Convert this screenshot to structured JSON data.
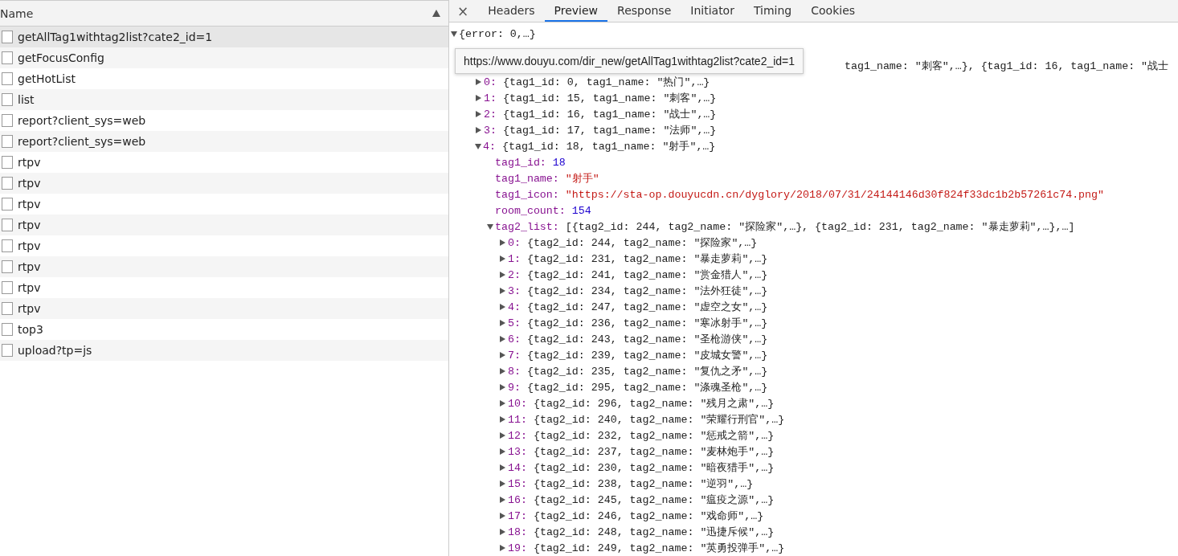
{
  "requests": {
    "column": "Name",
    "sorted_ascending": true,
    "rows": [
      {
        "name": "getAllTag1withtag2list?cate2_id=1",
        "selected": true
      },
      {
        "name": "getFocusConfig",
        "selected": false
      },
      {
        "name": "getHotList",
        "selected": false
      },
      {
        "name": "list",
        "selected": false
      },
      {
        "name": "report?client_sys=web",
        "selected": false
      },
      {
        "name": "report?client_sys=web",
        "selected": false
      },
      {
        "name": "rtpv",
        "selected": false
      },
      {
        "name": "rtpv",
        "selected": false
      },
      {
        "name": "rtpv",
        "selected": false
      },
      {
        "name": "rtpv",
        "selected": false
      },
      {
        "name": "rtpv",
        "selected": false
      },
      {
        "name": "rtpv",
        "selected": false
      },
      {
        "name": "rtpv",
        "selected": false
      },
      {
        "name": "rtpv",
        "selected": false
      },
      {
        "name": "top3",
        "selected": false
      },
      {
        "name": "upload?tp=js",
        "selected": false
      }
    ]
  },
  "detail": {
    "close": "×",
    "tabs": [
      {
        "label": "Headers",
        "selected": false
      },
      {
        "label": "Preview",
        "selected": true
      },
      {
        "label": "Response",
        "selected": false
      },
      {
        "label": "Initiator",
        "selected": false
      },
      {
        "label": "Timing",
        "selected": false
      },
      {
        "label": "Cookies",
        "selected": false
      }
    ],
    "tooltip": "https://www.douyu.com/dir_new/getAllTag1withtag2list?cate2_id=1",
    "tree": [
      {
        "value": "{error: 0,…}",
        "kind": "object",
        "expanded": true,
        "children": [
          {
            "kind": "partial",
            "value": "tag1_name: \"刺客\",…}, {tag1_id: 16, tag1_name: \"战士",
            "children": [
              {
                "key": "0:",
                "value": "{tag1_id: 0, tag1_name: \"热门\",…}",
                "kind": "object",
                "expanded": false
              },
              {
                "key": "1:",
                "value": "{tag1_id: 15, tag1_name: \"刺客\",…}",
                "kind": "object",
                "expanded": false
              },
              {
                "key": "2:",
                "value": "{tag1_id: 16, tag1_name: \"战士\",…}",
                "kind": "object",
                "expanded": false
              },
              {
                "key": "3:",
                "value": "{tag1_id: 17, tag1_name: \"法师\",…}",
                "kind": "object",
                "expanded": false
              },
              {
                "key": "4:",
                "value": "{tag1_id: 18, tag1_name: \"射手\",…}",
                "kind": "object",
                "expanded": true,
                "children": [
                  {
                    "key": "tag1_id:",
                    "value": "18",
                    "kind": "number"
                  },
                  {
                    "key": "tag1_name:",
                    "value": "\"射手\"",
                    "kind": "string"
                  },
                  {
                    "key": "tag1_icon:",
                    "value": "\"https://sta-op.douyucdn.cn/dyglory/2018/07/31/24144146d30f824f33dc1b2b57261c74.png\"",
                    "kind": "string"
                  },
                  {
                    "key": "room_count:",
                    "value": "154",
                    "kind": "number"
                  },
                  {
                    "key": "tag2_list:",
                    "value": "[{tag2_id: 244, tag2_name: \"探险家\",…}, {tag2_id: 231, tag2_name: \"暴走萝莉\",…},…]",
                    "kind": "object",
                    "expanded": true,
                    "children": [
                      {
                        "key": "0:",
                        "value": "{tag2_id: 244, tag2_name: \"探险家\",…}",
                        "kind": "object",
                        "expanded": false
                      },
                      {
                        "key": "1:",
                        "value": "{tag2_id: 231, tag2_name: \"暴走萝莉\",…}",
                        "kind": "object",
                        "expanded": false
                      },
                      {
                        "key": "2:",
                        "value": "{tag2_id: 241, tag2_name: \"赏金猎人\",…}",
                        "kind": "object",
                        "expanded": false
                      },
                      {
                        "key": "3:",
                        "value": "{tag2_id: 234, tag2_name: \"法外狂徒\",…}",
                        "kind": "object",
                        "expanded": false
                      },
                      {
                        "key": "4:",
                        "value": "{tag2_id: 247, tag2_name: \"虚空之女\",…}",
                        "kind": "object",
                        "expanded": false
                      },
                      {
                        "key": "5:",
                        "value": "{tag2_id: 236, tag2_name: \"寒冰射手\",…}",
                        "kind": "object",
                        "expanded": false
                      },
                      {
                        "key": "6:",
                        "value": "{tag2_id: 243, tag2_name: \"圣枪游侠\",…}",
                        "kind": "object",
                        "expanded": false
                      },
                      {
                        "key": "7:",
                        "value": "{tag2_id: 239, tag2_name: \"皮城女警\",…}",
                        "kind": "object",
                        "expanded": false
                      },
                      {
                        "key": "8:",
                        "value": "{tag2_id: 235, tag2_name: \"复仇之矛\",…}",
                        "kind": "object",
                        "expanded": false
                      },
                      {
                        "key": "9:",
                        "value": "{tag2_id: 295, tag2_name: \"涤魂圣枪\",…}",
                        "kind": "object",
                        "expanded": false
                      },
                      {
                        "key": "10:",
                        "value": "{tag2_id: 296, tag2_name: \"残月之肃\",…}",
                        "kind": "object",
                        "expanded": false
                      },
                      {
                        "key": "11:",
                        "value": "{tag2_id: 240, tag2_name: \"荣耀行刑官\",…}",
                        "kind": "object",
                        "expanded": false
                      },
                      {
                        "key": "12:",
                        "value": "{tag2_id: 232, tag2_name: \"惩戒之箭\",…}",
                        "kind": "object",
                        "expanded": false
                      },
                      {
                        "key": "13:",
                        "value": "{tag2_id: 237, tag2_name: \"麦林炮手\",…}",
                        "kind": "object",
                        "expanded": false
                      },
                      {
                        "key": "14:",
                        "value": "{tag2_id: 230, tag2_name: \"暗夜猎手\",…}",
                        "kind": "object",
                        "expanded": false
                      },
                      {
                        "key": "15:",
                        "value": "{tag2_id: 238, tag2_name: \"逆羽\",…}",
                        "kind": "object",
                        "expanded": false
                      },
                      {
                        "key": "16:",
                        "value": "{tag2_id: 245, tag2_name: \"瘟疫之源\",…}",
                        "kind": "object",
                        "expanded": false
                      },
                      {
                        "key": "17:",
                        "value": "{tag2_id: 246, tag2_name: \"戏命师\",…}",
                        "kind": "object",
                        "expanded": false
                      },
                      {
                        "key": "18:",
                        "value": "{tag2_id: 248, tag2_name: \"迅捷斥候\",…}",
                        "kind": "object",
                        "expanded": false
                      },
                      {
                        "key": "19:",
                        "value": "{tag2_id: 249, tag2_name: \"英勇投弹手\",…}",
                        "kind": "object",
                        "expanded": false
                      }
                    ]
                  }
                ]
              }
            ]
          }
        ]
      }
    ]
  }
}
